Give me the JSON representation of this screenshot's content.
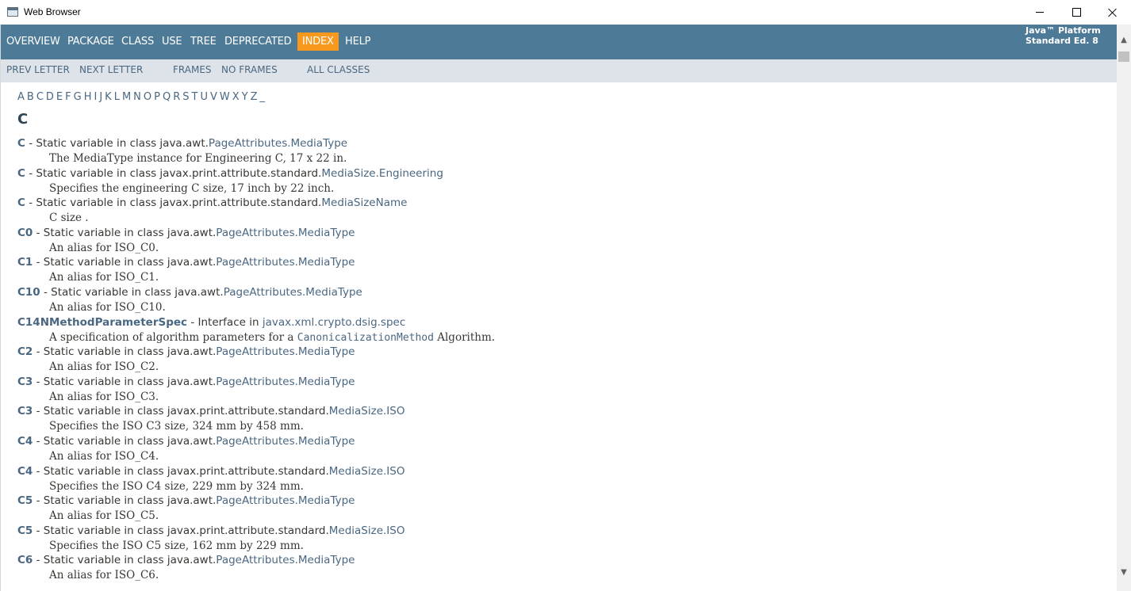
{
  "window": {
    "title": "Web Browser"
  },
  "topnav": {
    "items": [
      "OVERVIEW",
      "PACKAGE",
      "CLASS",
      "USE",
      "TREE",
      "DEPRECATED",
      "INDEX",
      "HELP"
    ],
    "active": "INDEX",
    "about_line1": "Java™ Platform",
    "about_line2": "Standard Ed. 8"
  },
  "subnav": {
    "prev_letter": "PREV LETTER",
    "next_letter": "NEXT LETTER",
    "frames": "FRAMES",
    "no_frames": "NO FRAMES",
    "all_classes": "ALL CLASSES"
  },
  "letters": [
    "A",
    "B",
    "C",
    "D",
    "E",
    "F",
    "G",
    "H",
    "I",
    "J",
    "K",
    "L",
    "M",
    "N",
    "O",
    "P",
    "Q",
    "R",
    "S",
    "T",
    "U",
    "V",
    "W",
    "X",
    "Y",
    "Z",
    "_"
  ],
  "section_title": "C",
  "entries": [
    {
      "term": "C",
      "desc_prefix": " - Static variable in class java.awt.",
      "link": "PageAttributes.MediaType",
      "detail": "The MediaType instance for Engineering C, 17 x 22 in."
    },
    {
      "term": "C",
      "desc_prefix": " - Static variable in class javax.print.attribute.standard.",
      "link": "MediaSize.Engineering",
      "detail": "Specifies the engineering C size, 17 inch by 22 inch."
    },
    {
      "term": "C",
      "desc_prefix": " - Static variable in class javax.print.attribute.standard.",
      "link": "MediaSizeName",
      "detail": "C size ."
    },
    {
      "term": "C0",
      "desc_prefix": " - Static variable in class java.awt.",
      "link": "PageAttributes.MediaType",
      "detail": "An alias for ISO_C0."
    },
    {
      "term": "C1",
      "desc_prefix": " - Static variable in class java.awt.",
      "link": "PageAttributes.MediaType",
      "detail": "An alias for ISO_C1."
    },
    {
      "term": "C10",
      "desc_prefix": " - Static variable in class java.awt.",
      "link": "PageAttributes.MediaType",
      "detail": "An alias for ISO_C10."
    },
    {
      "term": "C14NMethodParameterSpec",
      "desc_prefix": " - Interface in ",
      "link": "javax.xml.crypto.dsig.spec",
      "detail_prefix": "A specification of algorithm parameters for a ",
      "detail_code": "CanonicalizationMethod",
      "detail_suffix": " Algorithm."
    },
    {
      "term": "C2",
      "desc_prefix": " - Static variable in class java.awt.",
      "link": "PageAttributes.MediaType",
      "detail": "An alias for ISO_C2."
    },
    {
      "term": "C3",
      "desc_prefix": " - Static variable in class java.awt.",
      "link": "PageAttributes.MediaType",
      "detail": "An alias for ISO_C3."
    },
    {
      "term": "C3",
      "desc_prefix": " - Static variable in class javax.print.attribute.standard.",
      "link": "MediaSize.ISO",
      "detail": "Specifies the ISO C3 size, 324 mm by 458 mm."
    },
    {
      "term": "C4",
      "desc_prefix": " - Static variable in class java.awt.",
      "link": "PageAttributes.MediaType",
      "detail": "An alias for ISO_C4."
    },
    {
      "term": "C4",
      "desc_prefix": " - Static variable in class javax.print.attribute.standard.",
      "link": "MediaSize.ISO",
      "detail": "Specifies the ISO C4 size, 229 mm by 324 mm."
    },
    {
      "term": "C5",
      "desc_prefix": " - Static variable in class java.awt.",
      "link": "PageAttributes.MediaType",
      "detail": "An alias for ISO_C5."
    },
    {
      "term": "C5",
      "desc_prefix": " - Static variable in class javax.print.attribute.standard.",
      "link": "MediaSize.ISO",
      "detail": "Specifies the ISO C5 size, 162 mm by 229 mm."
    },
    {
      "term": "C6",
      "desc_prefix": " - Static variable in class java.awt.",
      "link": "PageAttributes.MediaType",
      "detail": "An alias for ISO_C6."
    }
  ],
  "scrollbar": {
    "up_icon": "scroll-up-arrow-icon",
    "down_icon": "scroll-down-arrow-icon"
  },
  "colors": {
    "nav_bg": "#4d7a97",
    "nav_active": "#f8981d",
    "subnav_bg": "#dee3e9",
    "link": "#4a6782"
  }
}
